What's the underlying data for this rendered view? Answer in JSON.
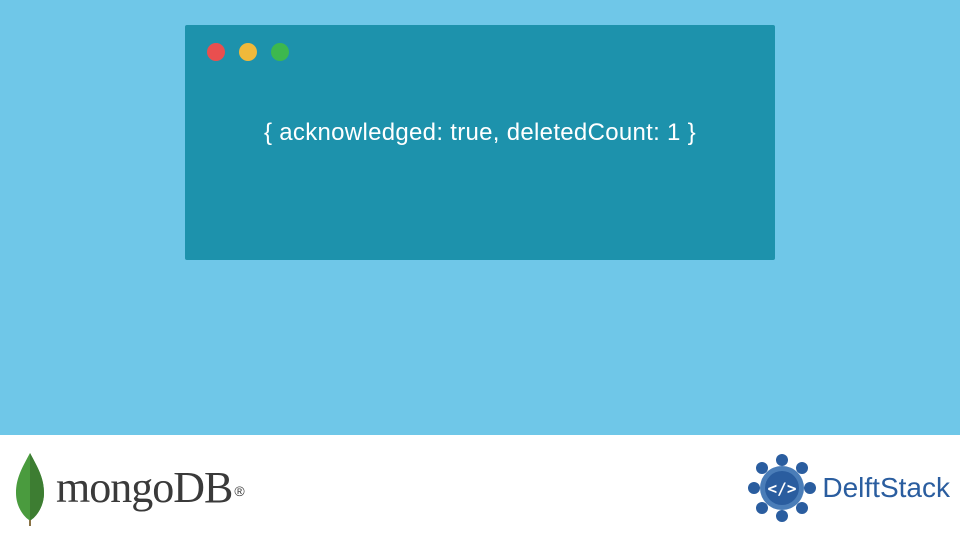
{
  "terminal": {
    "output": "{ acknowledged: true, deletedCount: 1 }"
  },
  "logos": {
    "mongodb": {
      "text": "mongoDB",
      "registered": "®"
    },
    "delftstack": {
      "text": "DelftStack"
    }
  }
}
